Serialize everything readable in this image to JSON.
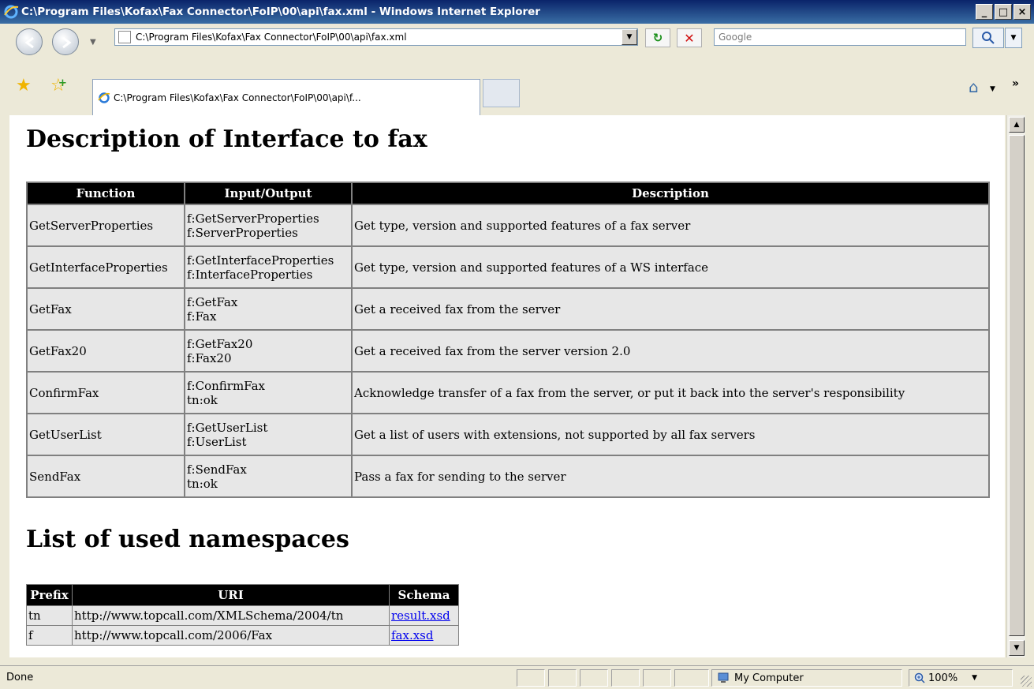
{
  "window": {
    "title": "C:\\Program Files\\Kofax\\Fax Connector\\FoIP\\00\\api\\fax.xml - Windows Internet Explorer",
    "min_label": "_",
    "max_label": "□",
    "close_label": "×"
  },
  "addressbar": {
    "url": "C:\\Program Files\\Kofax\\Fax Connector\\FoIP\\00\\api\\fax.xml"
  },
  "search": {
    "placeholder": "Google"
  },
  "tabs": [
    {
      "label": "C:\\Program Files\\Kofax\\Fax Connector\\FoIP\\00\\api\\f..."
    }
  ],
  "page": {
    "heading1": "Description of Interface to fax",
    "table_headers": [
      "Function",
      "Input/Output",
      "Description"
    ],
    "rows": [
      {
        "function": "GetServerProperties",
        "io1": "f:GetServerProperties",
        "io2": "f:ServerProperties",
        "description": "Get type, version and supported features of a fax server"
      },
      {
        "function": "GetInterfaceProperties",
        "io1": "f:GetInterfaceProperties",
        "io2": "f:InterfaceProperties",
        "description": "Get type, version and supported features of a WS interface"
      },
      {
        "function": "GetFax",
        "io1": "f:GetFax",
        "io2": "f:Fax",
        "description": "Get a received fax from the server"
      },
      {
        "function": "GetFax20",
        "io1": "f:GetFax20",
        "io2": "f:Fax20",
        "description": "Get a received fax from the server version 2.0"
      },
      {
        "function": "ConfirmFax",
        "io1": "f:ConfirmFax",
        "io2": "tn:ok",
        "description": "Acknowledge transfer of a fax from the server, or put it back into the server's responsibility"
      },
      {
        "function": "GetUserList",
        "io1": "f:GetUserList",
        "io2": "f:UserList",
        "description": "Get a list of users with extensions, not supported by all fax servers"
      },
      {
        "function": "SendFax",
        "io1": "f:SendFax",
        "io2": "tn:ok",
        "description": "Pass a fax for sending to the server"
      }
    ],
    "heading2": "List of used namespaces",
    "ns_headers": [
      "Prefix",
      "URI",
      "Schema"
    ],
    "namespaces": [
      {
        "prefix": "tn",
        "uri": "http://www.topcall.com/XMLSchema/2004/tn",
        "schema": "result.xsd"
      },
      {
        "prefix": "f",
        "uri": "http://www.topcall.com/2006/Fax",
        "schema": "fax.xsd"
      }
    ]
  },
  "statusbar": {
    "status": "Done",
    "zone": "My Computer",
    "zoom": "100%"
  },
  "colors": {
    "titlebar": "#0a246a",
    "table_header_bg": "#000000",
    "cell_bg": "#e7e7e7",
    "link": "#0000ee"
  },
  "icons": [
    "ie-logo-icon",
    "back-icon",
    "forward-icon",
    "refresh-icon",
    "stop-icon",
    "search-icon",
    "favorites-star-icon",
    "add-favorites-icon",
    "home-icon",
    "computer-icon",
    "zoom-icon"
  ]
}
